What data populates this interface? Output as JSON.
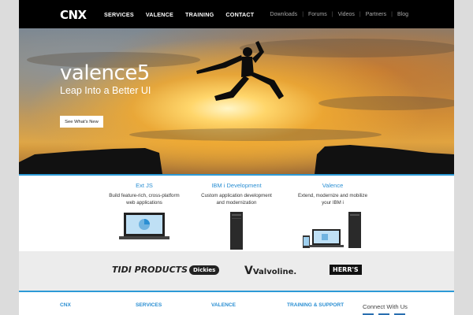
{
  "header": {
    "logo": "CNX",
    "main_nav": [
      "SERVICES",
      "VALENCE",
      "TRAINING",
      "CONTACT"
    ],
    "util_nav": [
      "Downloads",
      "Forums",
      "Videos",
      "Partners",
      "Blog"
    ]
  },
  "hero": {
    "brand": "valence5",
    "tagline": "Leap Into a Better UI",
    "button": "See What's New"
  },
  "products": [
    {
      "title": "Ext JS",
      "desc_line1": "Build feature-rich, cross-platform",
      "desc_line2": "web applications"
    },
    {
      "title": "IBM i Development",
      "desc_line1": "Custom application development",
      "desc_line2": "and modernization"
    },
    {
      "title": "Valence",
      "desc_line1": "Extend, modernize and mobilize",
      "desc_line2": "your IBM i"
    }
  ],
  "clients": [
    "TIDI PRODUCTS",
    "Dickies",
    "Valvoline.",
    "HERR'S"
  ],
  "footer": {
    "columns": [
      "CNX",
      "SERVICES",
      "VALENCE",
      "TRAINING & SUPPORT"
    ],
    "connect": "Connect With Us"
  },
  "colors": {
    "accent": "#2b8fd3",
    "header_bg": "#000000",
    "clients_bg": "#ececec"
  }
}
